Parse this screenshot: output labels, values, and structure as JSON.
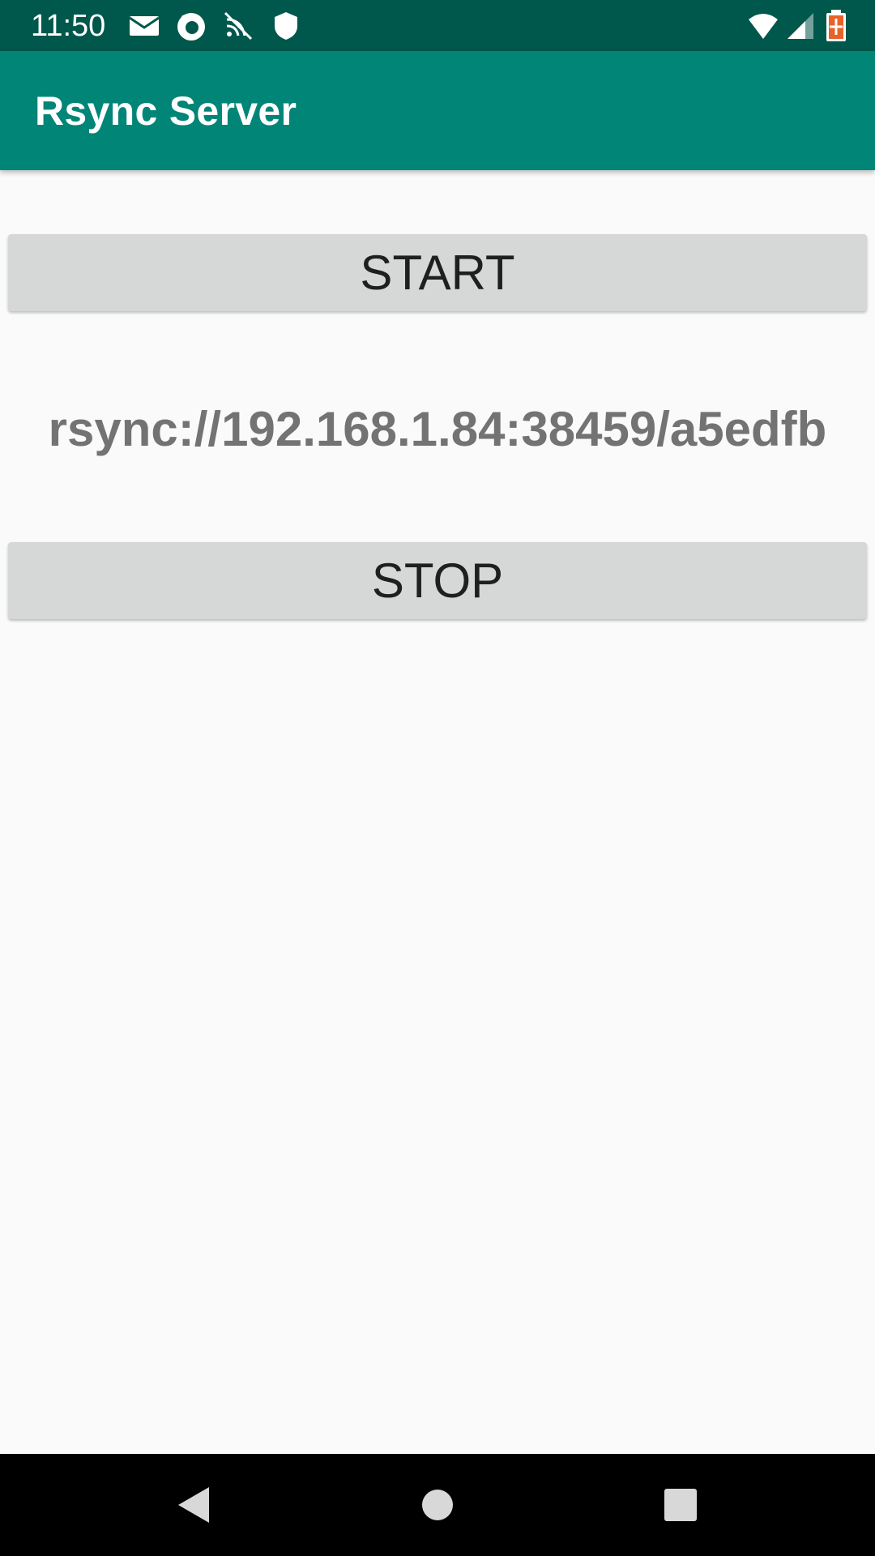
{
  "status_bar": {
    "time": "11:50",
    "icons_left": [
      "mail-icon",
      "firefox-icon",
      "wireless-sync-icon",
      "shield-icon"
    ],
    "icons_right": [
      "wifi-icon",
      "cell-signal-icon",
      "battery-charging-icon"
    ]
  },
  "app_bar": {
    "title": "Rsync Server"
  },
  "main": {
    "start_label": "START",
    "url": "rsync://192.168.1.84:38459/a5edfb",
    "stop_label": "STOP"
  },
  "nav_bar": {
    "icons": [
      "back-icon",
      "home-icon",
      "recents-icon"
    ]
  },
  "colors": {
    "status_bar": "#00574b",
    "app_bar": "#008577",
    "background": "#fafafa",
    "button": "#d6d7d7",
    "url_text": "#737373"
  }
}
